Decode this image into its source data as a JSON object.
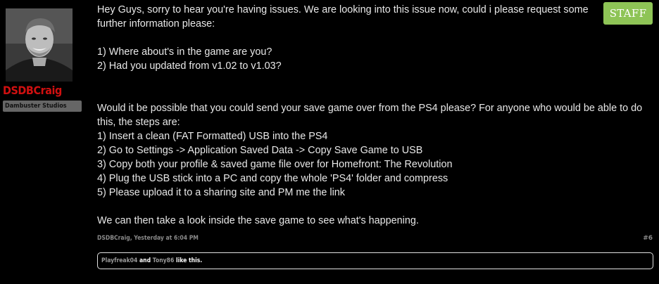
{
  "user": {
    "name": "DSDBCraig",
    "title": "Dambuster Studios"
  },
  "badge": {
    "label": "STAFF",
    "color": "#8ec456"
  },
  "message": {
    "lines": [
      "Hey Guys, sorry to hear you're having issues. We are looking into this issue now, could i please request some",
      "further information please:",
      "",
      "1) Where about's in the game are you?",
      "2) Had you updated from v1.02 to v1.03?",
      "",
      "",
      "Would it be possible that you could send your save game over from the PS4 please? For anyone who would be able to do",
      "this, the steps are:",
      "1) Insert a clean (FAT Formatted) USB into the PS4",
      "2) Go to Settings -> Application Saved Data -> Copy Save Game to USB",
      "3) Copy both your profile & saved game file over for Homefront: The Revolution",
      "4) Plug the USB stick into a PC and copy the whole 'PS4' folder and compress",
      "5) Please upload it to a sharing site and PM me the link",
      "",
      "We can then take a look inside the save game to see what's happening."
    ]
  },
  "meta": {
    "author": "DSDBCraig",
    "separator": ",",
    "time": "Yesterday at 6:04 PM",
    "post_number": "#6"
  },
  "likes": {
    "user1": "Playfreak04",
    "and": "and",
    "user2": "Tony86",
    "suffix": "like this."
  }
}
